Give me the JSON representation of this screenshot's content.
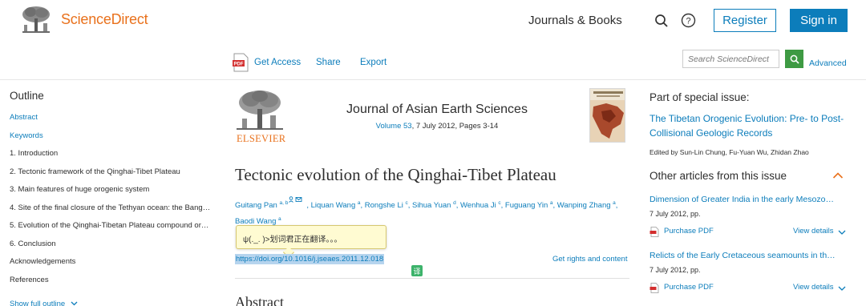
{
  "header": {
    "brand": "ScienceDirect",
    "journals_link": "Journals & Books",
    "register_label": "Register",
    "signin_label": "Sign in",
    "brand_color": "#e9711c",
    "accent_color": "#0c7dbb"
  },
  "toolbar": {
    "get_access": "Get Access",
    "share": "Share",
    "export": "Export",
    "search_placeholder": "Search ScienceDirect",
    "advanced": "Advanced",
    "search_button_color": "#3e9a43"
  },
  "outline": {
    "title": "Outline",
    "items": [
      {
        "label": "Abstract",
        "link": true
      },
      {
        "label": "Keywords",
        "link": true
      },
      {
        "label": "1. Introduction",
        "link": false
      },
      {
        "label": "2. Tectonic framework of the Qinghai-Tibet Plateau",
        "link": false
      },
      {
        "label": "3. Main features of huge orogenic system",
        "link": false
      },
      {
        "label": "4. Site of the final closure of the Tethyan ocean: the Bang…",
        "link": false
      },
      {
        "label": "5. Evolution of the Qinghai-Tibetan Plateau compound or…",
        "link": false
      },
      {
        "label": "6. Conclusion",
        "link": false
      },
      {
        "label": "Acknowledgements",
        "link": false
      },
      {
        "label": "References",
        "link": false
      }
    ],
    "show_full": "Show full outline"
  },
  "article": {
    "publisher": "ELSEVIER",
    "journal_name": "Journal of Asian Earth Sciences",
    "volume_link": "Volume 53",
    "volume_rest": ", 7 July 2012, Pages 3-14",
    "title": "Tectonic evolution of the Qinghai-Tibet Plateau",
    "authors": [
      {
        "name": "Guitang Pan",
        "sup": "a, b"
      },
      {
        "name": "Liquan Wang",
        "sup": "a"
      },
      {
        "name": "Rongshe Li",
        "sup": "c"
      },
      {
        "name": "Sihua Yuan",
        "sup": "d"
      },
      {
        "name": "Wenhua Ji",
        "sup": "c"
      },
      {
        "name": "Fuguang Yin",
        "sup": "a"
      },
      {
        "name": "Wanping Zhang",
        "sup": "a"
      },
      {
        "name": "Baodi Wang",
        "sup": "a"
      }
    ],
    "tooltip": "ψ(._. )>划词君正在翻译。。。",
    "doi": "https://doi.org/10.1016/j.jseaes.2011.12.018",
    "translate_badge": "译",
    "rights": "Get rights and content",
    "abstract_heading": "Abstract"
  },
  "right": {
    "special_label": "Part of special issue:",
    "special_title": "The Tibetan Orogenic Evolution: Pre- to Post-Collisional Geologic Records",
    "editors": "Edited by Sun-Lin Chung, Fu-Yuan Wu, Zhidan Zhao",
    "other_heading": "Other articles from this issue",
    "articles": [
      {
        "title": "Dimension of Greater India in the early Mesozo…",
        "date": "7 July 2012, pp.",
        "pdf": "Purchase PDF",
        "view": "View details"
      },
      {
        "title": "Relicts of the Early Cretaceous seamounts in th…",
        "date": "7 July 2012, pp.",
        "pdf": "Purchase PDF",
        "view": "View details"
      }
    ]
  }
}
